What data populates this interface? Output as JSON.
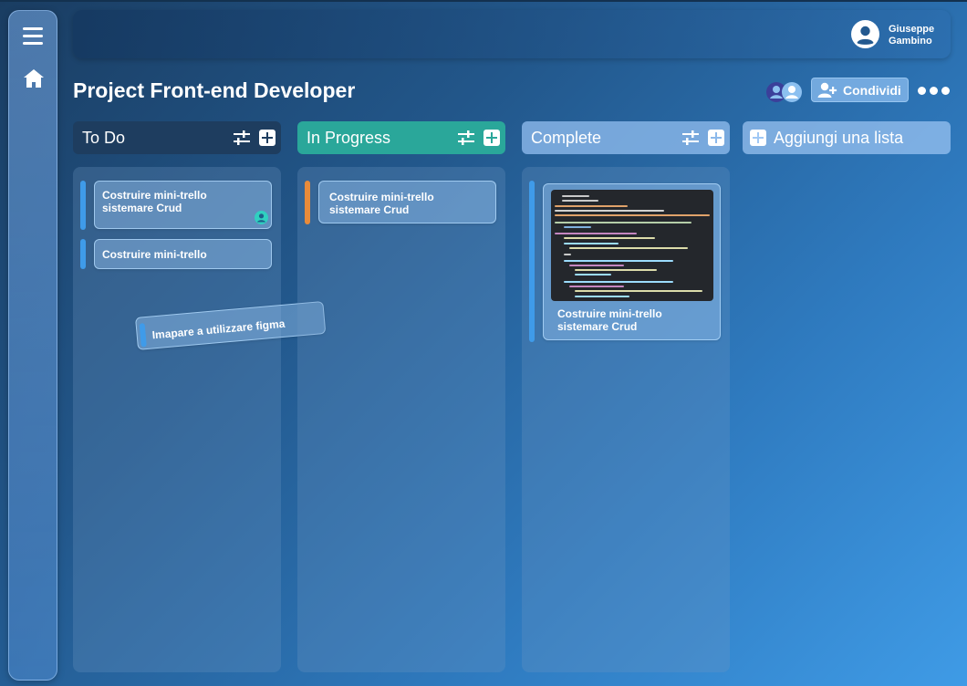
{
  "user": {
    "first_name": "Giuseppe",
    "last_name": "Gambino"
  },
  "page": {
    "title": "Project Front-end Developer"
  },
  "actions": {
    "share_label": "Condividi"
  },
  "lists": {
    "todo": {
      "title": "To Do"
    },
    "progress": {
      "title": "In Progress"
    },
    "complete": {
      "title": "Complete"
    },
    "add": {
      "label": "Aggiungi una lista"
    }
  },
  "cards": {
    "todo_1": {
      "line1": "Costruire mini-trello",
      "line2": "sistemare Crud"
    },
    "todo_2": {
      "text": "Costruire mini-trello"
    },
    "dragging": {
      "text": "Imapare a utilizzare figma"
    },
    "progress_1": {
      "line1": "Costruire mini-trello",
      "line2": "sistemare Crud"
    },
    "complete_1": {
      "line1": "Costruire mini-trello",
      "line2": "sistemare Crud"
    }
  },
  "colors": {
    "todo_header": "#1e3d5f",
    "progress_header": "#2aa79a",
    "complete_header": "#8cb9eb",
    "accent_blue": "#3f9be9",
    "accent_orange": "#e98b3a",
    "member_avatar": "#3b3f9a"
  },
  "icons": [
    "hamburger-icon",
    "home-icon",
    "user-avatar-icon",
    "add-user-icon",
    "more-dots-icon",
    "filter-icon",
    "plus-icon",
    "assignee-icon"
  ]
}
